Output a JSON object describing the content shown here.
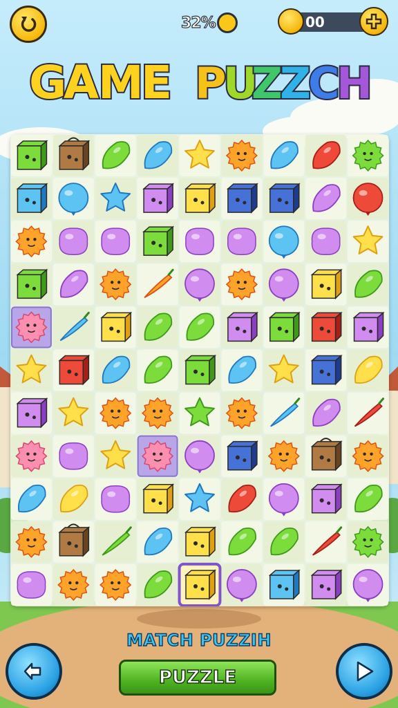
{
  "top_bar": {
    "undo_icon": "undo-arrow-icon",
    "progress_percent": 32,
    "progress_text": "32%",
    "progress_icon": "clock-coin-icon",
    "coins_icon": "coin-stack-icon",
    "coins_value": "00",
    "add_coins_icon": "plus-icon"
  },
  "title": {
    "word1": "GAME",
    "word2": "PUZZCH",
    "word1_letters": [
      "G",
      "A",
      "M",
      "E"
    ],
    "word1_colors": [
      "#ffd21f",
      "#ffd21f",
      "#ffd21f",
      "#ffd21f"
    ],
    "word2_letters": [
      "P",
      "U",
      "Z",
      "Z",
      "C",
      "H"
    ],
    "word2_colors": [
      "#f5c21a",
      "#9ed82a",
      "#3fc86a",
      "#2fb2e8",
      "#3e7de8",
      "#a457d8"
    ]
  },
  "board": {
    "columns": 9,
    "rows": 11,
    "cells": [
      [
        "cube-green",
        "box-brown",
        "bean-green",
        "bean-blue",
        "star-yellow",
        "sun-orange",
        "bean-blue",
        "bean-red",
        "blob-green"
      ],
      [
        "cube-blue",
        "ball-blue",
        "star-blue",
        "cube-purple",
        "cube-yellow",
        "cube-navy",
        "cube-navy",
        "bean-purple",
        "ball-red"
      ],
      [
        "blob-orange",
        "blob-purple",
        "blob-purple",
        "cube-green",
        "blob-purple",
        "blob-purple",
        "ball-blue",
        "blob-purple",
        "star-yellow"
      ],
      [
        "cube-green",
        "bean-purple",
        "sun-orange",
        "pepper-orange",
        "ball-purple",
        "sun-orange",
        "ball-purple",
        "cube-yellow",
        "bean-green"
      ],
      [
        "blob-pink",
        "pepper-blue",
        "cube-yellow",
        "bean-green",
        "bean-green",
        "cube-purple",
        "cube-green",
        "cube-red",
        "cube-purple"
      ],
      [
        "star-yellow",
        "cube-red",
        "bean-blue",
        "bean-green",
        "cube-green",
        "bean-blue",
        "star-yellow",
        "cube-navy",
        "bean-yellow"
      ],
      [
        "cube-purple",
        "star-yellow",
        "sun-orange",
        "sun-orange",
        "star-green",
        "sun-orange",
        "pepper-blue",
        "bean-purple",
        "pepper-red"
      ],
      [
        "blob-pink",
        "blob-purple",
        "star-yellow",
        "blob-pink",
        "ball-purple",
        "cube-navy",
        "sun-orange",
        "box-brown",
        "blob-orange"
      ],
      [
        "bean-blue",
        "bean-yellow",
        "blob-purple",
        "cube-yellow",
        "star-blue",
        "bean-red",
        "ball-purple",
        "cube-purple",
        "bean-green"
      ],
      [
        "blob-orange",
        "box-brown",
        "pepper-green",
        "bean-blue",
        "cube-yellow",
        "bean-green",
        "bean-green",
        "pepper-red",
        "blob-green"
      ],
      [
        "blob-purple",
        "sun-orange",
        "sun-orange",
        "bean-green",
        "cube-yellow",
        "ball-purple",
        "cube-blue",
        "cube-purple",
        "ball-purple"
      ]
    ],
    "highlighted_cells": [
      [
        4,
        0
      ],
      [
        7,
        3
      ]
    ],
    "selected_cell": [
      10,
      4
    ]
  },
  "colors": {
    "board": "#eef4de",
    "highlight": "#b9a6e8",
    "selected": "#7f55c9",
    "sky": "#8fd3f0",
    "grass": "#7ec850"
  },
  "bottom": {
    "match_label": "MATCH PUZZIH",
    "puzzle_button_label": "PUZZLE",
    "back_icon": "back-arrow-icon",
    "next_icon": "play-arrow-icon"
  }
}
